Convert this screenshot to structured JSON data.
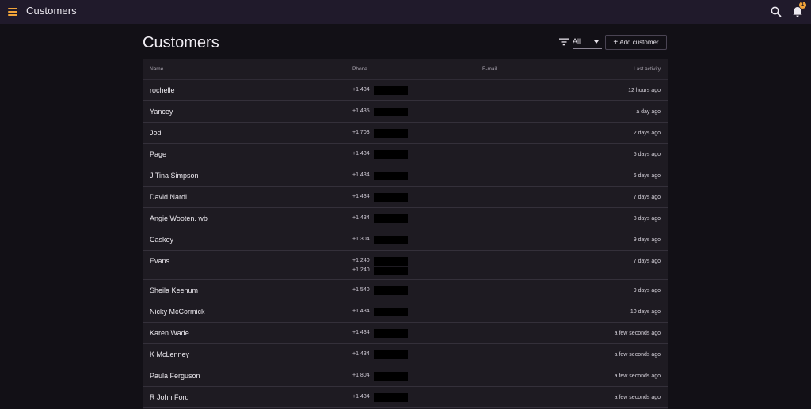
{
  "app": {
    "title": "Customers",
    "notification_count": "1"
  },
  "page": {
    "title": "Customers",
    "filter_value": "All",
    "add_button_label": "Add customer",
    "add_button_icon": "plus-icon"
  },
  "table": {
    "columns": {
      "name": "Name",
      "phone": "Phone",
      "email": "E-mail",
      "last_activity": "Last activity"
    },
    "rows": [
      {
        "name": "rochelle",
        "phones": [
          "+1 434"
        ],
        "email": "",
        "last_activity": "12 hours ago"
      },
      {
        "name": "Yancey",
        "phones": [
          "+1 435"
        ],
        "email": "",
        "last_activity": "a day ago"
      },
      {
        "name": "Jodi",
        "phones": [
          "+1 703"
        ],
        "email": "",
        "last_activity": "2 days ago"
      },
      {
        "name": "Page",
        "phones": [
          "+1 434"
        ],
        "email": "",
        "last_activity": "5 days ago"
      },
      {
        "name": "J Tina Simpson",
        "phones": [
          "+1 434"
        ],
        "email": "",
        "last_activity": "6 days ago"
      },
      {
        "name": "David Nardi",
        "phones": [
          "+1 434"
        ],
        "email": "",
        "last_activity": "7 days ago"
      },
      {
        "name": "Angie Wooten. wb",
        "phones": [
          "+1 434"
        ],
        "email": "",
        "last_activity": "8 days ago"
      },
      {
        "name": "Caskey",
        "phones": [
          "+1 304"
        ],
        "email": "",
        "last_activity": "9 days ago"
      },
      {
        "name": "Evans",
        "phones": [
          "+1 240",
          "+1 240"
        ],
        "email": "",
        "last_activity": "7 days ago"
      },
      {
        "name": "Sheila Keenum",
        "phones": [
          "+1 540"
        ],
        "email": "",
        "last_activity": "9 days ago"
      },
      {
        "name": "Nicky McCormick",
        "phones": [
          "+1 434"
        ],
        "email": "",
        "last_activity": "10 days ago"
      },
      {
        "name": "Karen Wade",
        "phones": [
          "+1 434"
        ],
        "email": "",
        "last_activity": "a few seconds ago"
      },
      {
        "name": "K McLenney",
        "phones": [
          "+1 434"
        ],
        "email": "",
        "last_activity": "a few seconds ago"
      },
      {
        "name": "Paula Ferguson",
        "phones": [
          "+1 804"
        ],
        "email": "",
        "last_activity": "a few seconds ago"
      },
      {
        "name": "R John Ford",
        "phones": [
          "+1 434"
        ],
        "email": "",
        "last_activity": "a few seconds ago"
      }
    ]
  },
  "colors": {
    "accent": "#f0a43a",
    "topbar": "#201a2b",
    "background": "#121016",
    "table_background": "#1e1b22"
  },
  "icons": {
    "menu": "hamburger-menu-icon",
    "search": "search-icon",
    "notifications": "bell-icon",
    "filter": "filter-icon",
    "dropdown": "caret-down-icon"
  }
}
